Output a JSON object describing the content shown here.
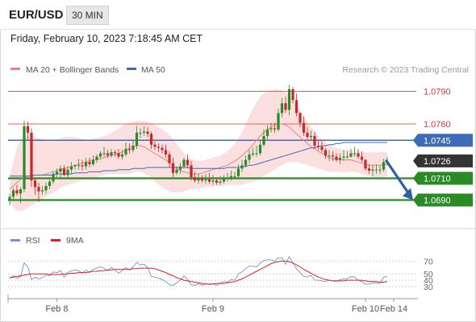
{
  "header": {
    "symbol": "EUR/USD",
    "interval": "30 MIN",
    "datetime": "Friday, February 10, 2023 7:18:45 AM CET"
  },
  "legend": {
    "ma20": "MA 20 + Bollinger Bands",
    "ma50": "MA 50",
    "rsi": "RSI",
    "ma9": "9MA"
  },
  "watermark": "Research © 2023 Trading Central",
  "colors": {
    "resistance": "#e0625a",
    "support": "#2a8a26",
    "ma50": "#3e6bb4",
    "bollinger": "#fbd9d9",
    "ma20": "#f08080",
    "current": "#333333",
    "rsi": "#6e94d6",
    "ma9": "#e02020",
    "arrow": "#2f5f9e"
  },
  "chart_data": [
    {
      "type": "candlestick",
      "symbol": "EUR/USD",
      "interval": "30 MIN",
      "ylim": [
        1.068,
        1.08
      ],
      "x_ticks": [
        "Feb 8",
        "Feb 9",
        "Feb 10",
        "Feb 14"
      ],
      "levels": [
        {
          "name": "resistance-2",
          "label": "1.0790",
          "value": 1.079,
          "kind": "resistance"
        },
        {
          "name": "resistance-1",
          "label": "1.0760",
          "value": 1.076,
          "kind": "resistance"
        },
        {
          "name": "pivot",
          "label": "1.0745",
          "value": 1.0745,
          "kind": "pivot"
        },
        {
          "name": "current-price",
          "label": "1.0726",
          "value": 1.0726,
          "kind": "current"
        },
        {
          "name": "support-1",
          "label": "1.0710",
          "value": 1.071,
          "kind": "support"
        },
        {
          "name": "support-2",
          "label": "1.0690",
          "value": 1.069,
          "kind": "support"
        }
      ],
      "forecast_arrow": {
        "from": 1.0726,
        "to": 1.069,
        "direction": "down"
      },
      "ohlc_open": [
        1.069,
        1.0693,
        1.0699,
        1.0696,
        1.07,
        1.0758,
        1.0752,
        1.0708,
        1.0702,
        1.0698,
        1.0699,
        1.0703,
        1.0707,
        1.0714,
        1.0716,
        1.0719,
        1.0713,
        1.0718,
        1.0721,
        1.0722,
        1.0722,
        1.0721,
        1.0725,
        1.0723,
        1.0727,
        1.073,
        1.0733,
        1.0733,
        1.0731,
        1.0734,
        1.0733,
        1.073,
        1.0732,
        1.0737,
        1.0736,
        1.074,
        1.0752,
        1.0752,
        1.0753,
        1.0751,
        1.0741,
        1.0739,
        1.0738,
        1.0736,
        1.0732,
        1.0724,
        1.0715,
        1.0718,
        1.0721,
        1.0727,
        1.0722,
        1.0711,
        1.0708,
        1.071,
        1.0708,
        1.0709,
        1.0707,
        1.0708,
        1.0706,
        1.0707,
        1.071,
        1.071,
        1.0712,
        1.0712,
        1.0719,
        1.0722,
        1.0727,
        1.0732,
        1.0733,
        1.0733,
        1.0741,
        1.0749,
        1.0755,
        1.0756,
        1.0755,
        1.077,
        1.0779,
        1.0773,
        1.0792,
        1.0782,
        1.077,
        1.0761,
        1.0752,
        1.0748,
        1.0749,
        1.074,
        1.0739,
        1.0736,
        1.0731,
        1.0731,
        1.073,
        1.0727,
        1.0729,
        1.073,
        1.073,
        1.0733,
        1.0733,
        1.073,
        1.0727,
        1.0719,
        1.0717,
        1.0718,
        1.0718,
        1.0718,
        1.0725
      ],
      "ohlc_high": [
        1.0696,
        1.0701,
        1.0704,
        1.0702,
        1.0763,
        1.0762,
        1.0756,
        1.071,
        1.0706,
        1.0703,
        1.0706,
        1.0709,
        1.0716,
        1.0719,
        1.0722,
        1.0722,
        1.0721,
        1.0725,
        1.0723,
        1.0728,
        1.0727,
        1.0729,
        1.0729,
        1.0731,
        1.0732,
        1.0735,
        1.0739,
        1.0736,
        1.0737,
        1.0736,
        1.0737,
        1.0736,
        1.0743,
        1.0742,
        1.0745,
        1.0758,
        1.0756,
        1.0758,
        1.0757,
        1.0753,
        1.0744,
        1.0742,
        1.0741,
        1.0741,
        1.0735,
        1.0729,
        1.0721,
        1.0724,
        1.0729,
        1.0732,
        1.0726,
        1.0716,
        1.0714,
        1.0713,
        1.0714,
        1.0715,
        1.0713,
        1.071,
        1.0712,
        1.0713,
        1.0715,
        1.0717,
        1.0716,
        1.0723,
        1.0727,
        1.0731,
        1.0736,
        1.0738,
        1.074,
        1.0745,
        1.0755,
        1.0759,
        1.0761,
        1.0761,
        1.0774,
        1.0784,
        1.0785,
        1.0796,
        1.0794,
        1.0788,
        1.0771,
        1.0767,
        1.0757,
        1.0754,
        1.0753,
        1.0745,
        1.0744,
        1.0738,
        1.0736,
        1.0735,
        1.0733,
        1.0733,
        1.0736,
        1.0735,
        1.0737,
        1.0739,
        1.0737,
        1.0735,
        1.0728,
        1.0723,
        1.0722,
        1.0723,
        1.0722,
        1.0728,
        1.073
      ],
      "ohlc_low": [
        1.0685,
        1.069,
        1.0694,
        1.0687,
        1.0697,
        1.0745,
        1.0702,
        1.0695,
        1.0688,
        1.0695,
        1.0696,
        1.07,
        1.0705,
        1.0711,
        1.071,
        1.0712,
        1.071,
        1.0714,
        1.0718,
        1.0718,
        1.0717,
        1.0718,
        1.072,
        1.0721,
        1.0724,
        1.0728,
        1.073,
        1.0729,
        1.0729,
        1.073,
        1.0728,
        1.0727,
        1.073,
        1.0733,
        1.0734,
        1.0737,
        1.0747,
        1.0749,
        1.0748,
        1.0737,
        1.0736,
        1.0734,
        1.0733,
        1.0729,
        1.072,
        1.0711,
        1.0713,
        1.0714,
        1.0719,
        1.0719,
        1.0708,
        1.0706,
        1.0705,
        1.0706,
        1.0705,
        1.0705,
        1.0704,
        1.0704,
        1.0704,
        1.0705,
        1.0707,
        1.0708,
        1.0709,
        1.071,
        1.0716,
        1.072,
        1.0724,
        1.073,
        1.073,
        1.0731,
        1.0739,
        1.0746,
        1.0752,
        1.0752,
        1.0753,
        1.0766,
        1.077,
        1.0768,
        1.0779,
        1.0767,
        1.0757,
        1.0749,
        1.0746,
        1.0745,
        1.0737,
        1.0736,
        1.0734,
        1.0728,
        1.0726,
        1.0726,
        1.0725,
        1.0723,
        1.0726,
        1.0728,
        1.0729,
        1.073,
        1.0728,
        1.0725,
        1.0717,
        1.0714,
        1.0712,
        1.0714,
        1.0714,
        1.0716,
        1.0722
      ],
      "ohlc_close": [
        1.0693,
        1.0699,
        1.0696,
        1.07,
        1.0758,
        1.0752,
        1.0708,
        1.0702,
        1.0698,
        1.0699,
        1.0703,
        1.0707,
        1.0714,
        1.0716,
        1.0719,
        1.0713,
        1.0718,
        1.0721,
        1.0722,
        1.0722,
        1.0721,
        1.0725,
        1.0723,
        1.0727,
        1.073,
        1.0733,
        1.0733,
        1.0731,
        1.0734,
        1.0733,
        1.073,
        1.0732,
        1.0737,
        1.0736,
        1.074,
        1.0752,
        1.0752,
        1.0753,
        1.0751,
        1.0741,
        1.0739,
        1.0738,
        1.0736,
        1.0732,
        1.0724,
        1.0715,
        1.0718,
        1.0721,
        1.0727,
        1.0722,
        1.0711,
        1.0708,
        1.071,
        1.0708,
        1.0709,
        1.0707,
        1.0708,
        1.0706,
        1.0707,
        1.071,
        1.071,
        1.0712,
        1.0712,
        1.0719,
        1.0722,
        1.0727,
        1.0732,
        1.0733,
        1.0733,
        1.0741,
        1.0749,
        1.0755,
        1.0756,
        1.0755,
        1.077,
        1.0779,
        1.0773,
        1.0792,
        1.0782,
        1.077,
        1.0761,
        1.0752,
        1.0748,
        1.0749,
        1.074,
        1.0739,
        1.0736,
        1.0731,
        1.0731,
        1.073,
        1.0727,
        1.0729,
        1.073,
        1.073,
        1.0733,
        1.0733,
        1.073,
        1.0727,
        1.0719,
        1.0717,
        1.0718,
        1.0718,
        1.0718,
        1.0725,
        1.0726
      ],
      "ma20": [
        1.07,
        1.0703,
        1.0706,
        1.0709,
        1.0711,
        1.0712,
        1.0713,
        1.0713,
        1.0713,
        1.0713,
        1.0714,
        1.0715,
        1.0716,
        1.0717,
        1.0718,
        1.0719,
        1.072,
        1.0721,
        1.0722,
        1.0723,
        1.0724,
        1.0725,
        1.0726,
        1.0727,
        1.0727,
        1.0728,
        1.0729,
        1.073,
        1.0731,
        1.0732,
        1.0733,
        1.0734,
        1.0736,
        1.0738,
        1.0739,
        1.074,
        1.074,
        1.0739,
        1.0737,
        1.0735,
        1.0733,
        1.0731,
        1.0729,
        1.0727,
        1.0724,
        1.0721,
        1.0719,
        1.0717,
        1.0716,
        1.0715,
        1.0714,
        1.0714,
        1.0714,
        1.0715,
        1.0716,
        1.0717,
        1.0718,
        1.0719,
        1.072,
        1.0721,
        1.0722,
        1.0724,
        1.0726,
        1.0728,
        1.0731,
        1.0734,
        1.0737,
        1.0741,
        1.0745,
        1.0749,
        1.0752,
        1.0755,
        1.0757,
        1.0759,
        1.076,
        1.076,
        1.0759,
        1.0757,
        1.0754,
        1.0751,
        1.0748,
        1.0745,
        1.0742,
        1.0739,
        1.0737,
        1.0735,
        1.0733,
        1.0731,
        1.0729,
        1.0728,
        1.0727,
        1.0727,
        1.0727,
        1.0727,
        1.0727,
        1.0726,
        1.0725,
        1.0724,
        1.0723,
        1.0722,
        1.0722,
        1.0722,
        1.0722,
        1.0723,
        1.0723
      ],
      "bb_upper": [
        1.0712,
        1.0725,
        1.0738,
        1.0745,
        1.0748,
        1.0749,
        1.0749,
        1.0748,
        1.0747,
        1.0746,
        1.0745,
        1.0745,
        1.0745,
        1.0746,
        1.0747,
        1.0748,
        1.0748,
        1.0748,
        1.0748,
        1.0747,
        1.0746,
        1.0745,
        1.0745,
        1.0746,
        1.0747,
        1.0748,
        1.0749,
        1.075,
        1.0752,
        1.0754,
        1.0756,
        1.0758,
        1.076,
        1.0761,
        1.0762,
        1.0763,
        1.0763,
        1.0763,
        1.0762,
        1.0761,
        1.0759,
        1.0757,
        1.0755,
        1.0753,
        1.075,
        1.0746,
        1.0742,
        1.0737,
        1.0733,
        1.073,
        1.0728,
        1.0727,
        1.0726,
        1.0726,
        1.0727,
        1.0728,
        1.0729,
        1.073,
        1.0731,
        1.0733,
        1.0735,
        1.0738,
        1.0742,
        1.0747,
        1.0753,
        1.076,
        1.0767,
        1.0774,
        1.078,
        1.0785,
        1.0788,
        1.079,
        1.0791,
        1.0792,
        1.0792,
        1.0791,
        1.0789,
        1.0786,
        1.0782,
        1.0777,
        1.0772,
        1.0767,
        1.0762,
        1.0757,
        1.0753,
        1.0749,
        1.0746,
        1.0743,
        1.0741,
        1.0739,
        1.0738,
        1.0737,
        1.0736,
        1.0736,
        1.0736,
        1.0735,
        1.0735,
        1.0734,
        1.0734,
        1.0734,
        1.0734,
        1.0734,
        1.0734,
        1.0734,
        1.0734
      ],
      "bb_lower": [
        1.0688,
        1.0683,
        1.068,
        1.068,
        1.0681,
        1.0683,
        1.0685,
        1.0687,
        1.0689,
        1.0691,
        1.0693,
        1.0695,
        1.0697,
        1.0699,
        1.0701,
        1.0703,
        1.0704,
        1.0705,
        1.0706,
        1.0707,
        1.0708,
        1.0709,
        1.071,
        1.071,
        1.0711,
        1.0712,
        1.0713,
        1.0714,
        1.0714,
        1.0714,
        1.0714,
        1.0714,
        1.0714,
        1.0714,
        1.0715,
        1.0716,
        1.0716,
        1.0715,
        1.0713,
        1.071,
        1.0707,
        1.0704,
        1.0702,
        1.07,
        1.0698,
        1.0697,
        1.0697,
        1.0697,
        1.0698,
        1.0699,
        1.07,
        1.07,
        1.0701,
        1.0701,
        1.0702,
        1.0702,
        1.0702,
        1.0703,
        1.0703,
        1.0703,
        1.0704,
        1.0704,
        1.0704,
        1.0704,
        1.0704,
        1.0705,
        1.0706,
        1.0707,
        1.0708,
        1.071,
        1.0712,
        1.0714,
        1.0716,
        1.0718,
        1.072,
        1.0722,
        1.0724,
        1.0725,
        1.0725,
        1.0725,
        1.0724,
        1.0723,
        1.0722,
        1.0721,
        1.072,
        1.0719,
        1.0718,
        1.0717,
        1.0716,
        1.0716,
        1.0716,
        1.0716,
        1.0716,
        1.0716,
        1.0716,
        1.0716,
        1.0715,
        1.0714,
        1.0713,
        1.0712,
        1.0711,
        1.0711,
        1.0711,
        1.0711,
        1.0712
      ],
      "ma50": [
        1.0712,
        1.0712,
        1.0712,
        1.0712,
        1.0712,
        1.0712,
        1.0712,
        1.0713,
        1.0713,
        1.0713,
        1.0713,
        1.0713,
        1.0713,
        1.0714,
        1.0714,
        1.0714,
        1.0714,
        1.0714,
        1.0715,
        1.0715,
        1.0715,
        1.0715,
        1.0716,
        1.0716,
        1.0716,
        1.0716,
        1.0717,
        1.0717,
        1.0717,
        1.0717,
        1.0718,
        1.0718,
        1.0718,
        1.0718,
        1.0719,
        1.0719,
        1.0719,
        1.0719,
        1.072,
        1.072,
        1.072,
        1.072,
        1.072,
        1.072,
        1.072,
        1.072,
        1.072,
        1.072,
        1.072,
        1.072,
        1.0719,
        1.0719,
        1.0719,
        1.0719,
        1.0719,
        1.0719,
        1.0719,
        1.0719,
        1.0719,
        1.0719,
        1.072,
        1.072,
        1.072,
        1.072,
        1.0721,
        1.0721,
        1.0722,
        1.0722,
        1.0723,
        1.0724,
        1.0725,
        1.0726,
        1.0727,
        1.0728,
        1.0729,
        1.073,
        1.0731,
        1.0732,
        1.0733,
        1.0734,
        1.0735,
        1.0736,
        1.0737,
        1.0738,
        1.0738,
        1.0739,
        1.074,
        1.074,
        1.0741,
        1.0741,
        1.0742,
        1.0742,
        1.0743,
        1.0743,
        1.0743,
        1.0743,
        1.0743,
        1.0743,
        1.0743,
        1.0743,
        1.0743,
        1.0743,
        1.0743,
        1.0743,
        1.0743
      ]
    },
    {
      "type": "line",
      "name": "rsi-panel",
      "ylim": [
        25,
        78
      ],
      "y_ticks": [
        70,
        50,
        40,
        30
      ],
      "series": [
        {
          "name": "RSI",
          "values": [
            43,
            47,
            43,
            46,
            67,
            61,
            41,
            45,
            42,
            44,
            48,
            47,
            53,
            52,
            55,
            45,
            52,
            55,
            56,
            55,
            51,
            56,
            52,
            57,
            59,
            61,
            59,
            55,
            60,
            56,
            51,
            55,
            60,
            56,
            61,
            68,
            64,
            65,
            60,
            46,
            45,
            43,
            41,
            38,
            33,
            32,
            36,
            40,
            47,
            41,
            33,
            32,
            35,
            32,
            35,
            33,
            35,
            32,
            35,
            38,
            37,
            41,
            40,
            50,
            53,
            58,
            62,
            62,
            61,
            67,
            71,
            72,
            72,
            70,
            75,
            75,
            65,
            77,
            67,
            58,
            52,
            46,
            45,
            48,
            40,
            40,
            39,
            38,
            40,
            39,
            38,
            41,
            42,
            42,
            46,
            45,
            40,
            38,
            34,
            34,
            36,
            36,
            35,
            45,
            46
          ]
        },
        {
          "name": "9MA",
          "values": [
            44,
            45,
            46,
            47,
            48,
            49,
            50,
            50,
            50,
            50,
            50,
            49,
            49,
            49,
            49,
            50,
            50,
            51,
            51,
            52,
            52,
            52,
            53,
            54,
            54,
            55,
            55,
            56,
            56,
            57,
            57,
            57,
            57,
            57,
            58,
            58,
            59,
            59,
            59,
            59,
            58,
            56,
            54,
            52,
            49,
            47,
            44,
            42,
            40,
            39,
            38,
            37,
            36,
            35,
            34,
            34,
            34,
            35,
            35,
            35,
            36,
            37,
            38,
            40,
            42,
            45,
            48,
            51,
            54,
            57,
            60,
            63,
            66,
            68,
            69,
            70,
            70,
            69,
            67,
            64,
            61,
            57,
            54,
            51,
            48,
            45,
            43,
            41,
            40,
            39,
            39,
            39,
            39,
            40,
            40,
            40,
            40,
            40,
            39,
            38,
            38,
            38,
            37,
            37,
            38
          ]
        }
      ],
      "x_ticks": [
        "Feb 8",
        "Feb 9",
        "Feb 10",
        "Feb 14"
      ]
    }
  ]
}
